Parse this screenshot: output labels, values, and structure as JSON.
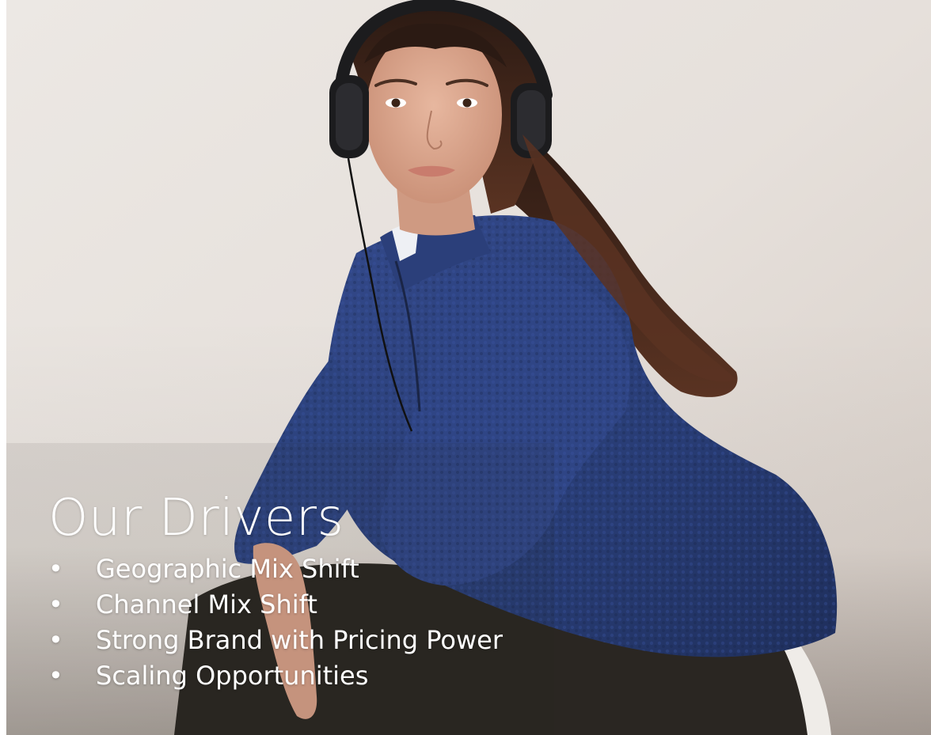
{
  "slide": {
    "title": "Our Drivers",
    "bullet_symbol": "•",
    "bullets": [
      "Geographic Mix Shift",
      "Channel Mix Shift",
      "Strong Brand with Pricing Power",
      "Scaling Opportunities"
    ]
  },
  "photo": {
    "subject": "woman wearing over-ear headphones and a navy fleece jacket",
    "colors": {
      "wall": "#e6e0db",
      "fleece": "#2a3f78",
      "hair": "#4a2a1c",
      "skin": "#d9a58d",
      "headphones": "#1c1c1e",
      "pants": "#2a2622",
      "text": "#ffffff"
    }
  }
}
